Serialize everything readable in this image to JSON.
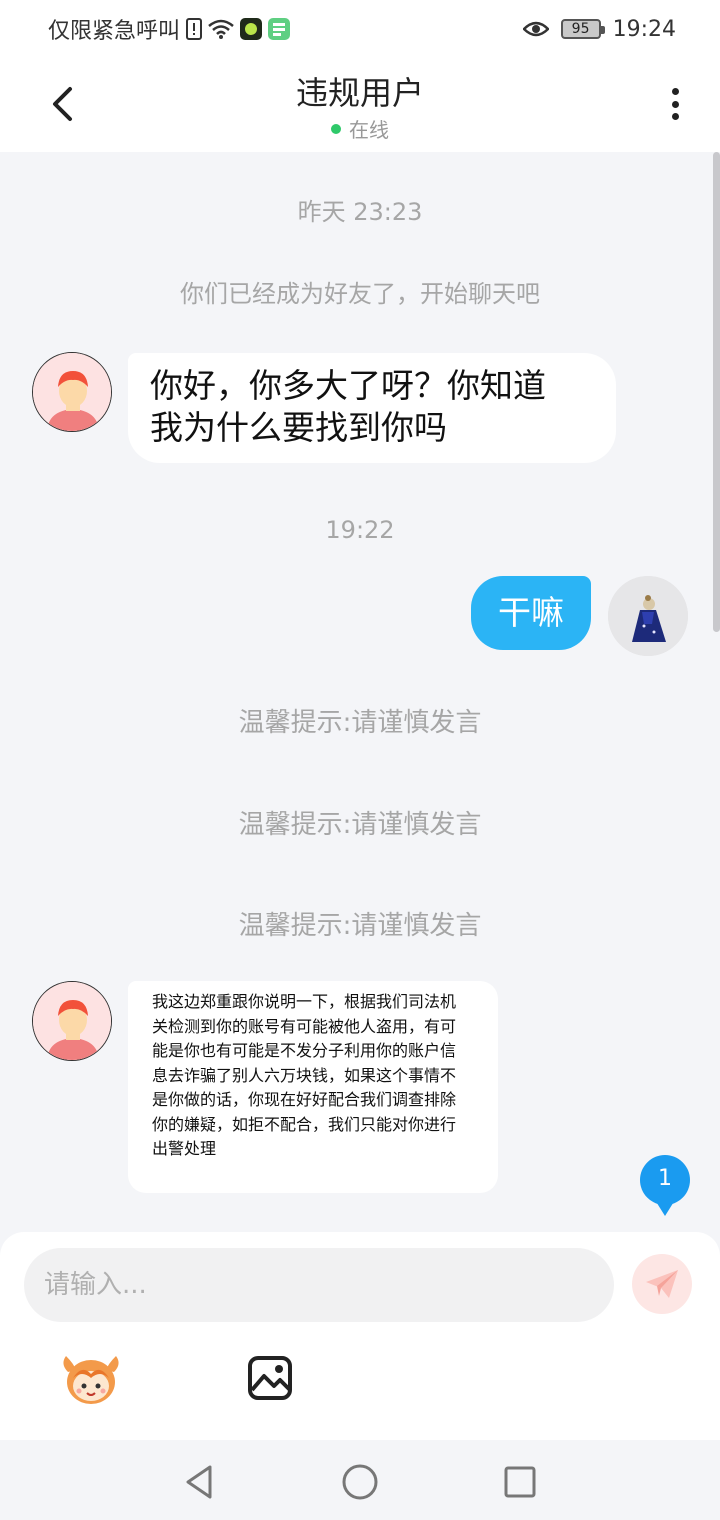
{
  "status_bar": {
    "carrier": "仅限紧急呼叫",
    "time": "19:24",
    "battery": "95",
    "icons": [
      "sim-alert-icon",
      "wifi-icon",
      "app-green-icon",
      "app-wechat-icon",
      "eye-icon",
      "battery-icon"
    ]
  },
  "header": {
    "title": "违规用户",
    "status": "在线"
  },
  "messages": {
    "time1": "昨天 23:23",
    "system_friend": "你们已经成为好友了，开始聊天吧",
    "msg1_line1": "你好，你多大了呀？你知道",
    "msg1_line2": "我为什么要找到你吗",
    "time2": "19:22",
    "msg2": "干嘛",
    "tip1": "温馨提示:请谨慎发言",
    "tip2": "温馨提示:请谨慎发言",
    "tip3": "温馨提示:请谨慎发言",
    "msg3_lines": [
      "我这边郑重跟你说明一下，根据我们司法机",
      "关检测到你的账号有可能被他人盗用，有可",
      "能是你也有可能是不发分子利用你的账户信",
      "息去诈骗了别人六万块钱，如果这个事情不",
      "是你做的话，你现在好好配合我们调查排除",
      "你的嫌疑，如拒不配合，我们只能对你进行",
      "出警处理"
    ]
  },
  "unread_badge": "1",
  "input": {
    "placeholder": "请输入..."
  },
  "colors": {
    "accent_blue": "#2bb4f5",
    "online_green": "#2fc96a",
    "background": "#f4f5f8"
  }
}
